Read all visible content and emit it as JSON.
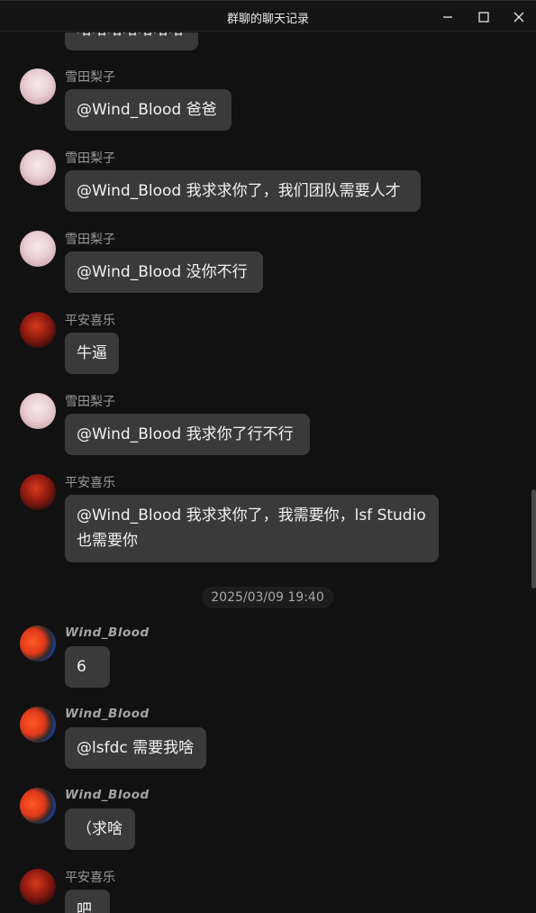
{
  "window": {
    "title": "群聊的聊天记录"
  },
  "messages": [
    {
      "sender": "",
      "avatar": "none",
      "text": "哈哈哈哈哈哈哈"
    },
    {
      "sender": "雪田梨子",
      "avatar": "pink",
      "text": "@Wind_Blood 爸爸"
    },
    {
      "sender": "雪田梨子",
      "avatar": "pink",
      "text": "@Wind_Blood 我求求你了，我们团队需要人才"
    },
    {
      "sender": "雪田梨子",
      "avatar": "pink",
      "text": "@Wind_Blood 没你不行"
    },
    {
      "sender": "平安喜乐",
      "avatar": "red",
      "text": "牛逼"
    },
    {
      "sender": "雪田梨子",
      "avatar": "pink",
      "text": "@Wind_Blood 我求你了行不行"
    },
    {
      "sender": "平安喜乐",
      "avatar": "red",
      "text": "@Wind_Blood 我求求你了，我需要你，lsf Studio也需要你"
    },
    {
      "timestamp": "2025/03/09 19:40"
    },
    {
      "sender": "Wind_Blood",
      "avatar": "wb",
      "text": "6"
    },
    {
      "sender": "Wind_Blood",
      "avatar": "wb",
      "text": "@lsfdc 需要我啥"
    },
    {
      "sender": "Wind_Blood",
      "avatar": "wb",
      "text": "（求啥"
    },
    {
      "sender": "平安喜乐",
      "avatar": "red",
      "text": "吧"
    }
  ],
  "colors": {
    "background": "#111111",
    "bubble": "#3a3a3a",
    "sender": "#9a9a9a"
  }
}
